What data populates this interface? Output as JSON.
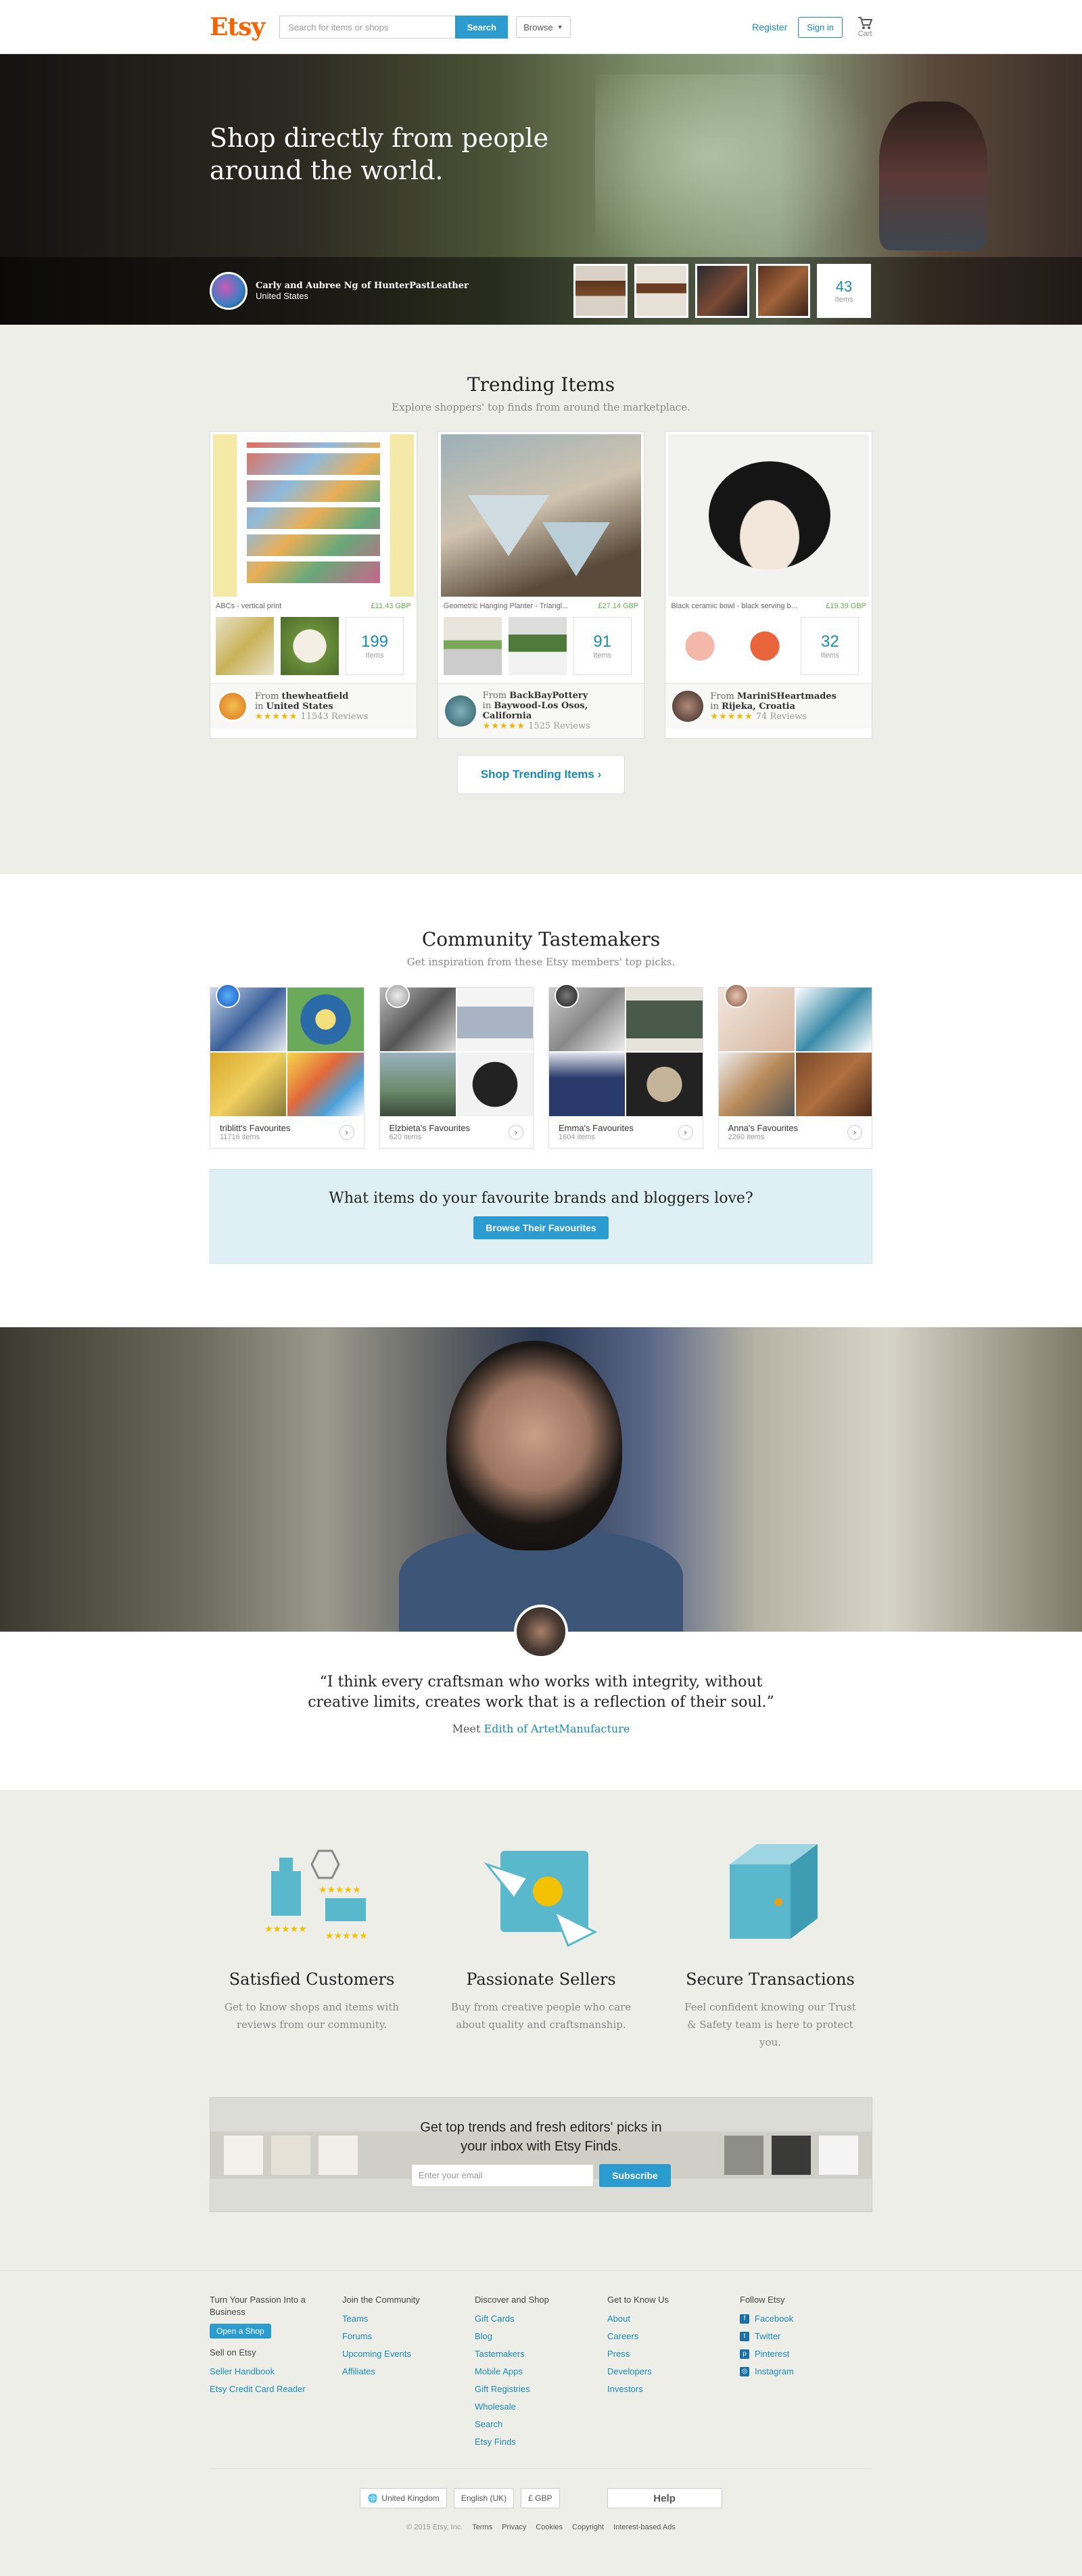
{
  "header": {
    "logo": "Etsy",
    "search_placeholder": "Search for items or shops",
    "search_button": "Search",
    "browse": "Browse",
    "register": "Register",
    "signin": "Sign in",
    "cart": "Cart"
  },
  "hero": {
    "title": "Shop directly from people around the world.",
    "seller_name": "Carly and Aubree Ng of HunterPastLeather",
    "seller_location": "United States",
    "item_count": "43",
    "items_label": "Items"
  },
  "trending": {
    "title": "Trending Items",
    "subtitle": "Explore shoppers' top finds from around the marketplace.",
    "cards": [
      {
        "caption": "ABCs - vertical print",
        "price": "£11.43 GBP",
        "count": "199",
        "items_label": "Items",
        "from": "From",
        "shop": "thewheatfield",
        "in": "in",
        "location": "United States",
        "reviews": "11543 Reviews",
        "stars": "★★★★★"
      },
      {
        "caption": "Geometric Hanging Planter - Triangl...",
        "price": "£27.14 GBP",
        "count": "91",
        "items_label": "Items",
        "from": "From",
        "shop": "BackBayPottery",
        "in": "in",
        "location": "Baywood-Los Osos, California",
        "reviews": "1525 Reviews",
        "stars": "★★★★★"
      },
      {
        "caption": "Black ceramic bowl - black serving b...",
        "price": "£19.39 GBP",
        "count": "32",
        "items_label": "Items",
        "from": "From",
        "shop": "MariniSHeartmades",
        "in": "in",
        "location": "Rijeka, Croatia",
        "reviews": "74 Reviews",
        "stars": "★★★★★"
      }
    ],
    "button": "Shop Trending Items ›"
  },
  "tastemakers": {
    "title": "Community Tastemakers",
    "subtitle": "Get inspiration from these Etsy members' top picks.",
    "cards": [
      {
        "title": "triblitt's Favourites",
        "items": "11716 items"
      },
      {
        "title": "Elzbieta's Favourites",
        "items": "620 items"
      },
      {
        "title": "Emma's Favourites",
        "items": "1604 items"
      },
      {
        "title": "Anna's Favourites",
        "items": "2260 items"
      }
    ],
    "brands_question": "What items do your favourite brands and bloggers love?",
    "brands_button": "Browse Their Favourites"
  },
  "story": {
    "quote": "“I think every craftsman who works with integrity, without creative limits, creates work that is a reflection of their soul.”",
    "meet": "Meet",
    "meet_link": "Edith of ArtetManufacture"
  },
  "values": [
    {
      "title": "Satisfied Customers",
      "text": "Get to know shops and items with reviews from our community."
    },
    {
      "title": "Passionate Sellers",
      "text": "Buy from creative people who care about quality and craftsmanship."
    },
    {
      "title": "Secure Transactions",
      "text": "Feel confident knowing our Trust & Safety team is here to protect you."
    }
  ],
  "finds": {
    "text": "Get top trends and fresh editors' picks in your inbox with Etsy Finds.",
    "email_placeholder": "Enter your email",
    "subscribe": "Subscribe"
  },
  "footer": {
    "col1": {
      "heading": "Turn Your Passion Into a Business",
      "open_shop": "Open a Shop",
      "sell_heading": "Sell on Etsy",
      "links": [
        "Seller Handbook",
        "Etsy Credit Card Reader"
      ]
    },
    "col2": {
      "heading": "Join the Community",
      "links": [
        "Teams",
        "Forums",
        "Upcoming Events",
        "Affiliates"
      ]
    },
    "col3": {
      "heading": "Discover and Shop",
      "links": [
        "Gift Cards",
        "Blog",
        "Tastemakers",
        "Mobile Apps",
        "Gift Registries",
        "Wholesale",
        "Search",
        "Etsy Finds"
      ]
    },
    "col4": {
      "heading": "Get to Know Us",
      "links": [
        "About",
        "Careers",
        "Press",
        "Developers",
        "Investors"
      ]
    },
    "col5": {
      "heading": "Follow Etsy",
      "links": [
        "Facebook",
        "Twitter",
        "Pinterest",
        "Instagram"
      ]
    },
    "region": "United Kingdom",
    "language": "English (UK)",
    "currency": "£ GBP",
    "help": "Help",
    "copyright": "© 2015 Etsy, Inc.",
    "legal": [
      "Terms",
      "Privacy",
      "Cookies",
      "Copyright",
      "Interest-based Ads"
    ]
  }
}
